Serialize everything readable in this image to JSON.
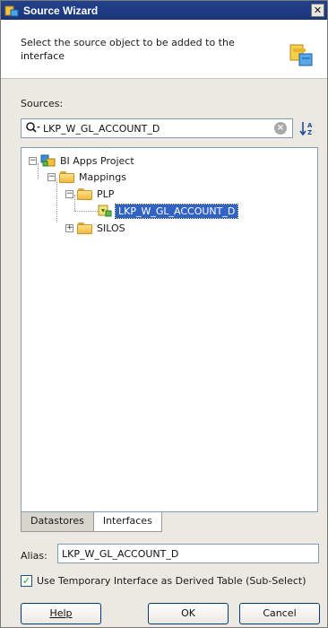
{
  "window": {
    "title": "Source Wizard"
  },
  "header": {
    "instruction": "Select the source object to be added to the interface"
  },
  "sources": {
    "label": "Sources:",
    "search_value": "LKP_W_GL_ACCOUNT_D"
  },
  "tree": {
    "project": "BI Apps Project",
    "mappings": "Mappings",
    "plp": "PLP",
    "selected_item": "LKP_W_GL_ACCOUNT_D",
    "silos": "SILOS"
  },
  "tabs": [
    {
      "label": "Datastores",
      "active": false
    },
    {
      "label": "Interfaces",
      "active": true
    }
  ],
  "alias": {
    "label": "Alias:",
    "value": "LKP_W_GL_ACCOUNT_D"
  },
  "option": {
    "label": "Use Temporary Interface as Derived Table (Sub-Select)",
    "checked": true
  },
  "buttons": {
    "help": "Help",
    "ok": "OK",
    "cancel": "Cancel"
  },
  "icons": {
    "title": "wizard-icon",
    "header": "datastore-add-icon",
    "search": "search-icon",
    "clear": "clear-icon",
    "sort": "sort-az-icon",
    "project": "project-icon",
    "folder": "folder-icon",
    "interface": "interface-icon"
  }
}
